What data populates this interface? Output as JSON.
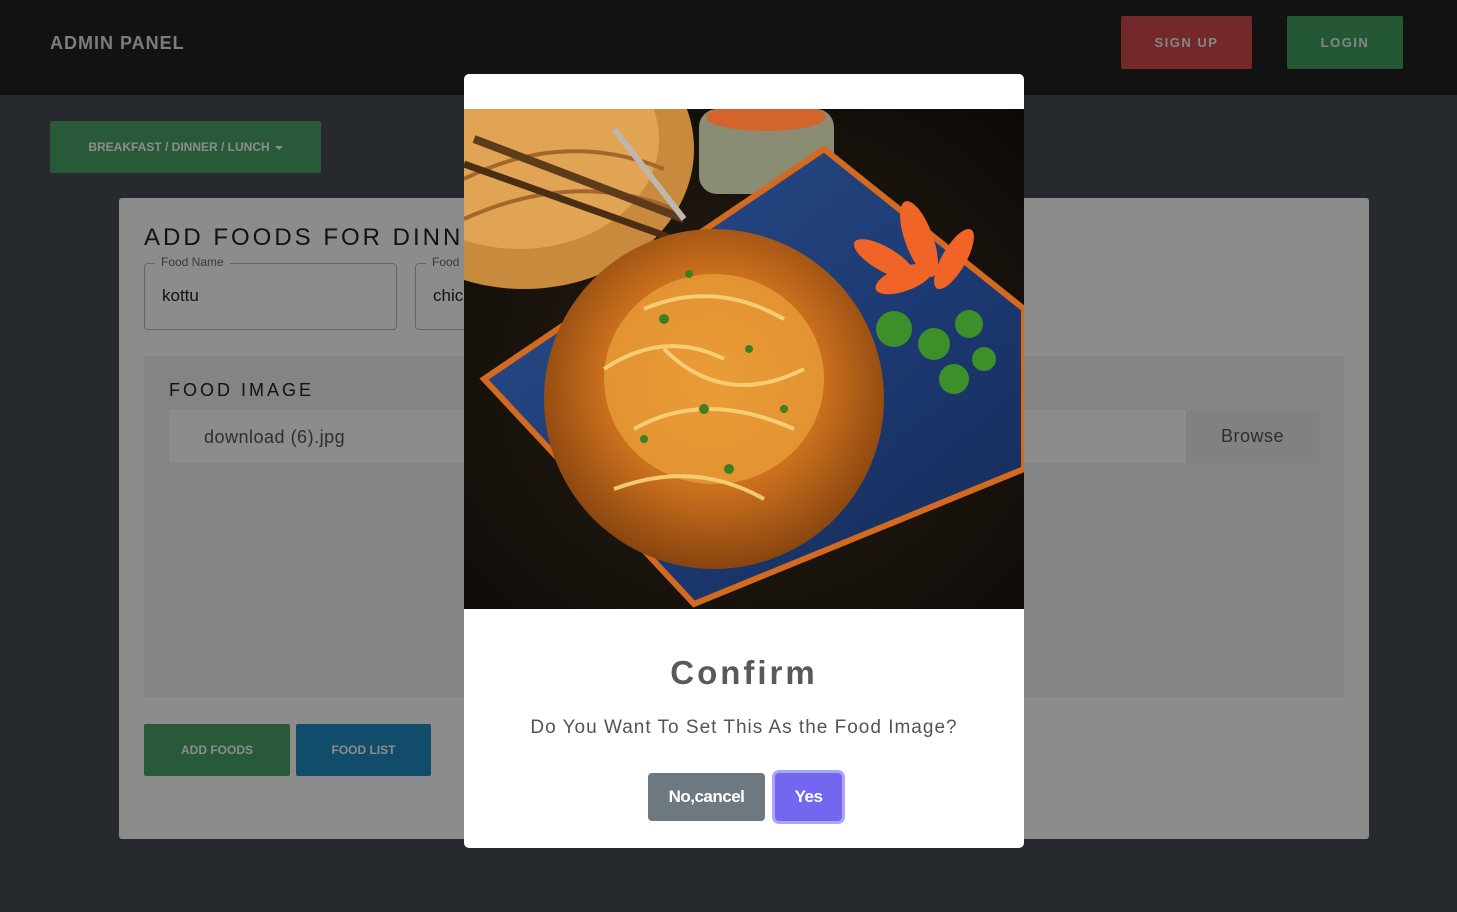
{
  "navbar": {
    "brand": "ADMIN PANEL",
    "signup_label": "SIGN UP",
    "login_label": "LOGIN"
  },
  "meal_selector": {
    "label": "BREAKFAST / DINNER / LUNCH"
  },
  "form": {
    "title": "ADD FOODS FOR DINNER",
    "food_name": {
      "legend": "Food Name",
      "value": "kottu"
    },
    "food_type": {
      "legend": "Food",
      "value": "chic"
    },
    "image_section": {
      "label": "FOOD IMAGE",
      "file_name": "download (6).jpg",
      "browse_label": "Browse"
    },
    "add_foods_label": "ADD FOODS",
    "food_list_label": "FOOD LIST"
  },
  "modal": {
    "image_icon": "food-photo",
    "title": "Confirm",
    "message": "Do You Want To Set This As the Food Image?",
    "cancel_label": "No,cancel",
    "confirm_label": "Yes"
  },
  "colors": {
    "navbar_bg": "#212121",
    "signup": "#d24b4b",
    "login": "#43a061",
    "add_foods": "#4aa568",
    "food_list": "#1f8cc4",
    "cancel": "#6e7881",
    "confirm": "#7367f0"
  }
}
